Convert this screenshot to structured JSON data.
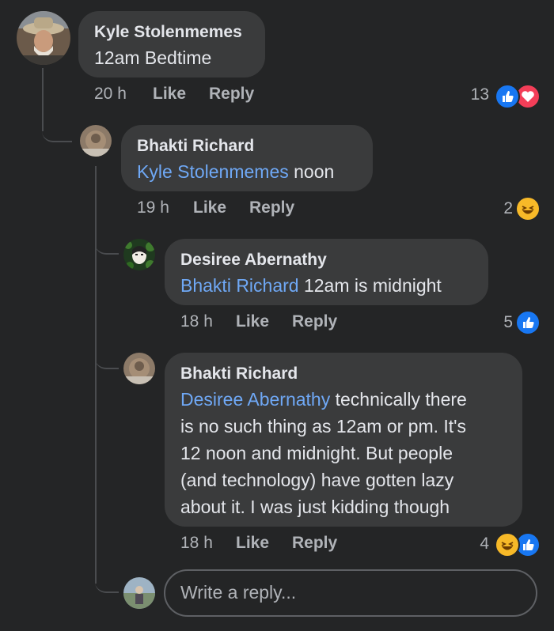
{
  "comments": [
    {
      "author": "Kyle Stolenmemes",
      "mention": "",
      "text": "12am Bedtime",
      "time": "20 h",
      "like": "Like",
      "reply": "Reply",
      "reaction_count": "13",
      "reactions": [
        "like-icon",
        "love-icon"
      ]
    },
    {
      "author": "Bhakti Richard",
      "mention": "Kyle Stolenmemes",
      "text": " noon",
      "time": "19 h",
      "like": "Like",
      "reply": "Reply",
      "reaction_count": "2",
      "reactions": [
        "haha-icon"
      ]
    },
    {
      "author": "Desiree Abernathy",
      "mention": "Bhakti Richard",
      "text": " 12am is midnight",
      "time": "18 h",
      "like": "Like",
      "reply": "Reply",
      "reaction_count": "5",
      "reactions": [
        "like-icon"
      ]
    },
    {
      "author": "Bhakti Richard",
      "mention": "Desiree Abernathy",
      "text_lines": [
        " technically there",
        "is no such thing as 12am or pm. It's",
        "12 noon and midnight. But people",
        "(and technology) have gotten lazy",
        "about it. I was just kidding though"
      ],
      "time": "18 h",
      "like": "Like",
      "reply": "Reply",
      "reaction_count": "4",
      "reactions": [
        "haha-icon",
        "like-icon"
      ]
    }
  ],
  "reply_box": {
    "placeholder": "Write a reply..."
  },
  "colors": {
    "background": "#242526",
    "bubble": "#3a3b3c",
    "mention": "#6fa8f5",
    "like_blue": "#1877f2",
    "love_red": "#f33e58",
    "haha_yellow": "#f7b928"
  }
}
